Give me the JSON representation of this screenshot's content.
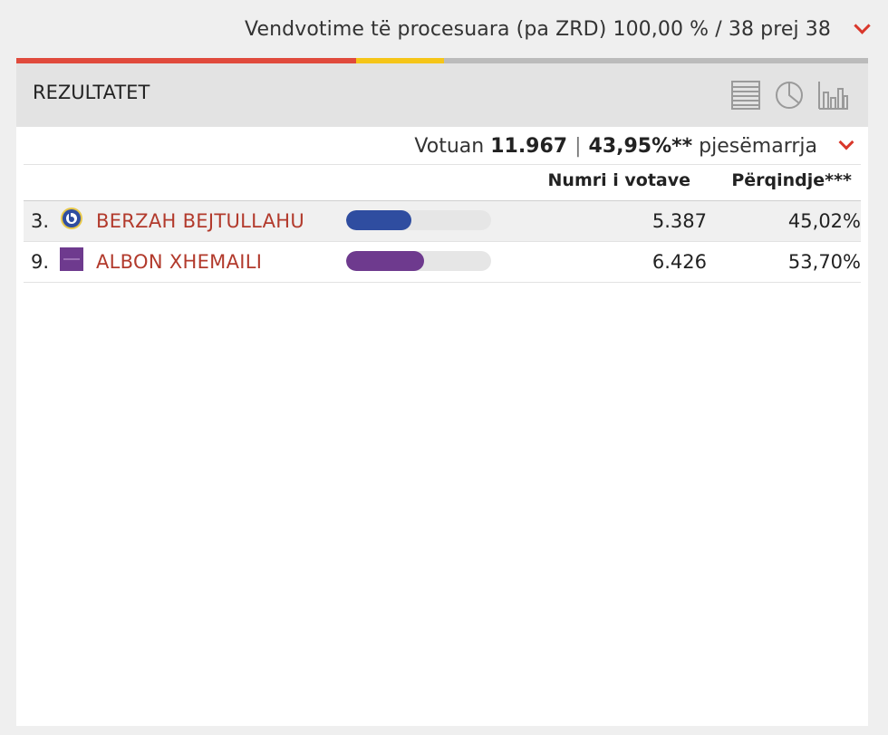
{
  "header": {
    "processed_text": "Vendvotime të procesuara (pa ZRD) 100,00 % / 38 prej 38"
  },
  "panel": {
    "title": "REZULTATET",
    "tools": [
      "table-view-icon",
      "pie-chart-icon",
      "bar-chart-icon"
    ]
  },
  "turnout": {
    "label": "Votuan",
    "votes": "11.967",
    "separator": "|",
    "percent": "43,95%**",
    "suffix": "pjesëmarrja"
  },
  "columns": {
    "votes": "Numri i votave",
    "percent": "Përqindje***"
  },
  "candidates": [
    {
      "number": "3.",
      "name": "BERZAH BEJTULLAHU",
      "votes": "5.387",
      "percent": "45,02%",
      "share": 0.4502,
      "color": "#2f4da0"
    },
    {
      "number": "9.",
      "name": "ALBON XHEMAILI",
      "votes": "6.426",
      "percent": "53,70%",
      "share": 0.537,
      "color": "#6e3a8e"
    }
  ],
  "colors": {
    "accent_red": "#d9372b",
    "progress_red": "#e04a3c",
    "progress_yellow": "#f5c518",
    "name_color": "#b23a2c"
  }
}
